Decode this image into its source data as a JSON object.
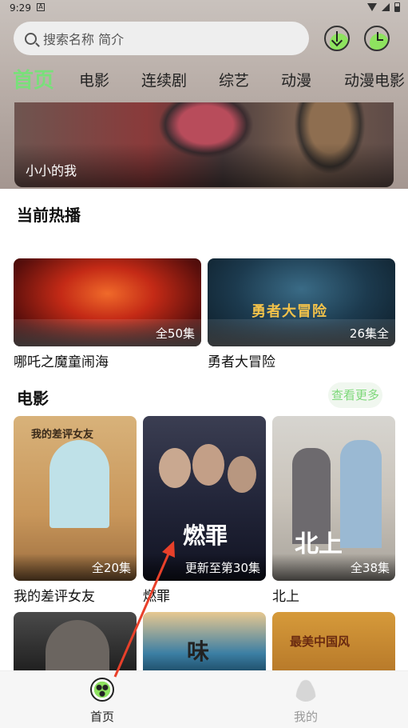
{
  "status": {
    "time": "9:29",
    "notification": "A"
  },
  "search": {
    "placeholder": "搜索名称 简介"
  },
  "tabs": [
    {
      "label": "首页",
      "active": true
    },
    {
      "label": "电影"
    },
    {
      "label": "连续剧"
    },
    {
      "label": "综艺"
    },
    {
      "label": "动漫"
    },
    {
      "label": "动漫电影"
    }
  ],
  "banner": {
    "title": "小小的我"
  },
  "hot": {
    "title": "当前热播",
    "items": [
      {
        "name": "哪吒之魔童闹海",
        "badge": "全50集"
      },
      {
        "name": "勇者大冒险",
        "badge": "26集全",
        "art_text": "勇者大冒险"
      }
    ]
  },
  "movies": {
    "title": "电影",
    "more_label": "查看更多",
    "items": [
      {
        "name": "我的差评女友",
        "badge": "全20集",
        "art_text": "我的差评女友"
      },
      {
        "name": "燃罪",
        "badge": "更新至第30集",
        "art_text": "燃罪"
      },
      {
        "name": "北上",
        "badge": "全38集",
        "art_text": "北上"
      }
    ],
    "row2": [
      {
        "art_text": ""
      },
      {
        "art_text": "味"
      },
      {
        "art_text": "最美中国风"
      }
    ]
  },
  "bottom_nav": [
    {
      "label": "首页",
      "active": true
    },
    {
      "label": "我的"
    }
  ],
  "colors": {
    "accent": "#79df7a",
    "more_bg": "#f0f7ef"
  }
}
